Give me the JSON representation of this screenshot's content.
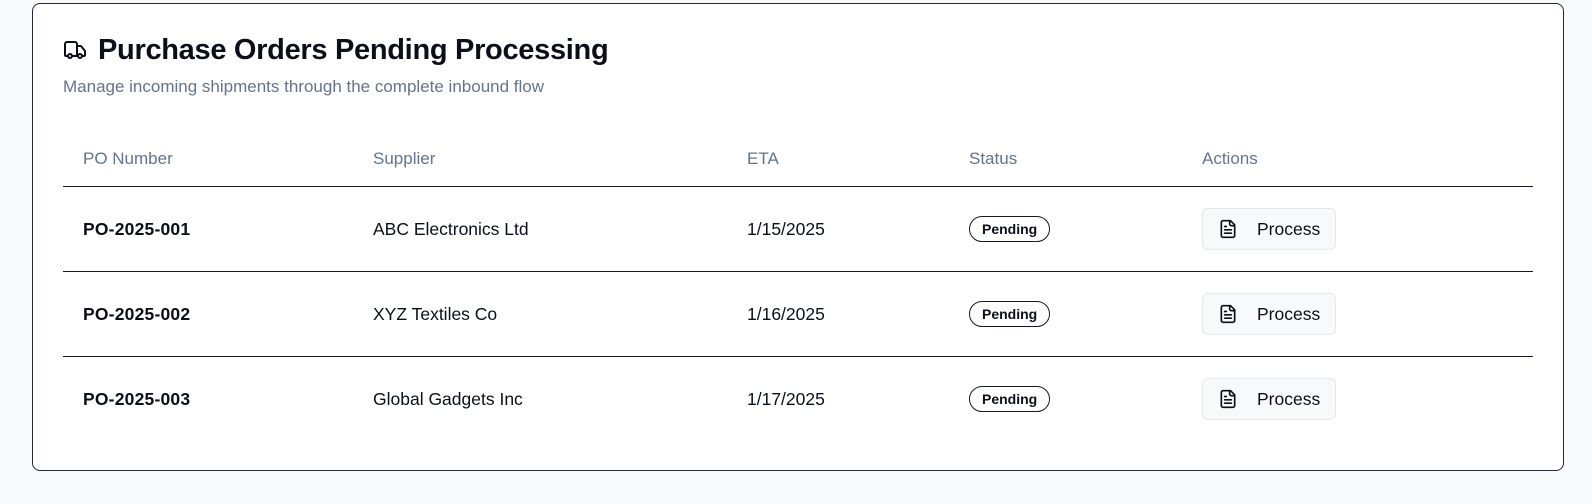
{
  "header": {
    "title": "Purchase Orders Pending Processing",
    "subtitle": "Manage incoming shipments through the complete inbound flow",
    "icon": "truck-icon"
  },
  "table": {
    "columns": [
      "PO Number",
      "Supplier",
      "ETA",
      "Status",
      "Actions"
    ],
    "rows": [
      {
        "po": "PO-2025-001",
        "supplier": "ABC Electronics Ltd",
        "eta": "1/15/2025",
        "status": "Pending",
        "action": "Process"
      },
      {
        "po": "PO-2025-002",
        "supplier": "XYZ Textiles Co",
        "eta": "1/16/2025",
        "status": "Pending",
        "action": "Process"
      },
      {
        "po": "PO-2025-003",
        "supplier": "Global Gadgets Inc",
        "eta": "1/17/2025",
        "status": "Pending",
        "action": "Process"
      }
    ]
  },
  "icons": {
    "action": "file-text-icon"
  }
}
